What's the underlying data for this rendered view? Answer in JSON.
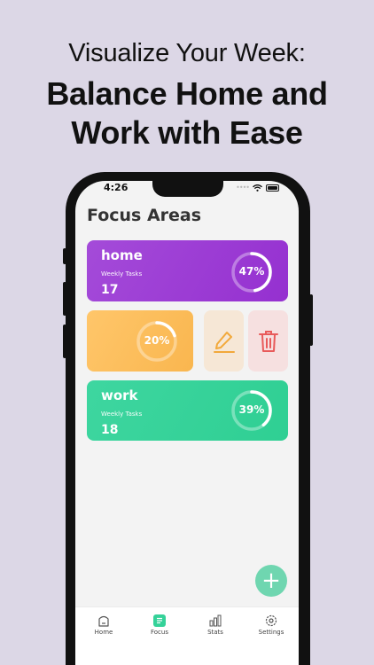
{
  "headline": {
    "line1": "Visualize Your Week:",
    "line2": "Balance Home and",
    "line3": "Work with Ease"
  },
  "status_bar": {
    "time": "4:26"
  },
  "page_title": "Focus Areas",
  "focus_areas": [
    {
      "name": "home",
      "subtitle": "Weekly Tasks",
      "count": "17",
      "percent_label": "47%",
      "progress": 0.47,
      "color": "#9e3fd6"
    },
    {
      "name": "",
      "subtitle": "",
      "count": "",
      "percent_label": "20%",
      "progress": 0.2,
      "color": "#fbbd58"
    },
    {
      "name": "work",
      "subtitle": "Weekly Tasks",
      "count": "18",
      "percent_label": "39%",
      "progress": 0.39,
      "color": "#35d299"
    }
  ],
  "swipe_actions": {
    "edit_icon": "pencil-icon",
    "delete_icon": "trash-icon"
  },
  "fab_label": "+",
  "tabs": [
    {
      "label": "Home",
      "icon": "home-icon"
    },
    {
      "label": "Focus",
      "icon": "list-icon",
      "active": true
    },
    {
      "label": "Stats",
      "icon": "bar-chart-icon"
    },
    {
      "label": "Settings",
      "icon": "gear-icon"
    }
  ],
  "colors": {
    "accent": "#35d299",
    "edit_bg": "#f6e7d6",
    "delete_bg": "#f6e0e0",
    "delete_icon": "#e85a5a",
    "edit_icon": "#f2a93b"
  }
}
